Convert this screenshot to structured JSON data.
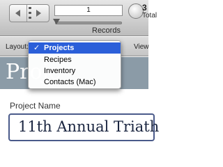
{
  "toolbar": {
    "record_number": "1",
    "records_label": "Records",
    "total_count": "3",
    "total_label": "Total"
  },
  "layout_bar": {
    "layout_label": "Layout:",
    "view_label": "View"
  },
  "layout_menu": {
    "items": [
      {
        "label": "Projects",
        "selected": true,
        "check": "✓"
      },
      {
        "label": "Recipes",
        "selected": false
      },
      {
        "label": "Inventory",
        "selected": false
      },
      {
        "label": "Contacts (Mac)",
        "selected": false
      }
    ]
  },
  "content": {
    "header_title": "Proje",
    "field_label": "Project Name",
    "field_value": "11th Annual Triath"
  },
  "colors": {
    "menu_highlight": "#2b5fd9",
    "header_band": "#8b9ba7",
    "field_border": "#4a5a8a"
  },
  "icons": [
    "previous-record-icon",
    "next-record-icon",
    "record-slider-thumb-icon",
    "pie-chart-icon",
    "checkmark-icon"
  ]
}
